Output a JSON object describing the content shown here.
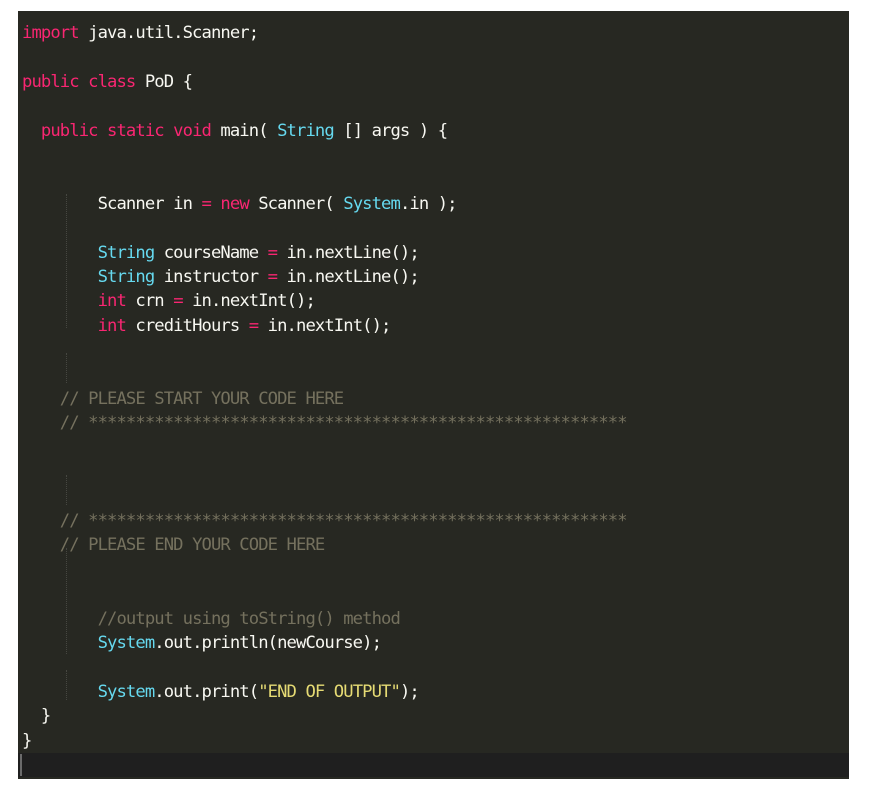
{
  "editor": {
    "theme_colors": {
      "background": "#272822",
      "keyword": "#f92672",
      "type": "#66d9ef",
      "string": "#e6db74",
      "comment": "#75715e",
      "text": "#f8f8f2"
    },
    "lines": [
      [
        {
          "t": "import",
          "c": "kw"
        },
        {
          "t": " java.util.Scanner;",
          "c": ""
        }
      ],
      [],
      [
        {
          "t": "public class",
          "c": "kw"
        },
        {
          "t": " PoD {",
          "c": ""
        }
      ],
      [],
      [
        {
          "t": "  "
        },
        {
          "t": "public static void",
          "c": "kw"
        },
        {
          "t": " main( ",
          "c": ""
        },
        {
          "t": "String",
          "c": "ty"
        },
        {
          "t": " [] args ) {",
          "c": ""
        }
      ],
      [],
      [],
      [
        {
          "t": "        Scanner in ",
          "c": ""
        },
        {
          "t": "=",
          "c": "kw"
        },
        {
          "t": " ",
          "c": ""
        },
        {
          "t": "new",
          "c": "kw"
        },
        {
          "t": " Scanner( ",
          "c": ""
        },
        {
          "t": "System",
          "c": "ty"
        },
        {
          "t": ".in );",
          "c": ""
        }
      ],
      [],
      [
        {
          "t": "        "
        },
        {
          "t": "String",
          "c": "ty"
        },
        {
          "t": " courseName ",
          "c": ""
        },
        {
          "t": "=",
          "c": "kw"
        },
        {
          "t": " in.nextLine();",
          "c": ""
        }
      ],
      [
        {
          "t": "        "
        },
        {
          "t": "String",
          "c": "ty"
        },
        {
          "t": " instructor ",
          "c": ""
        },
        {
          "t": "=",
          "c": "kw"
        },
        {
          "t": " in.nextLine();",
          "c": ""
        }
      ],
      [
        {
          "t": "        "
        },
        {
          "t": "int",
          "c": "kw"
        },
        {
          "t": " crn ",
          "c": ""
        },
        {
          "t": "=",
          "c": "kw"
        },
        {
          "t": " in.nextInt();",
          "c": ""
        }
      ],
      [
        {
          "t": "        "
        },
        {
          "t": "int",
          "c": "kw"
        },
        {
          "t": " creditHours ",
          "c": ""
        },
        {
          "t": "=",
          "c": "kw"
        },
        {
          "t": " in.nextInt();",
          "c": ""
        }
      ],
      [],
      [],
      [
        {
          "t": "    "
        },
        {
          "t": "// PLEASE START YOUR CODE HERE",
          "c": "cm"
        }
      ],
      [
        {
          "t": "    "
        },
        {
          "t": "// *********************************************************",
          "c": "cm"
        }
      ],
      [],
      [],
      [],
      [
        {
          "t": "    "
        },
        {
          "t": "// *********************************************************",
          "c": "cm"
        }
      ],
      [
        {
          "t": "    "
        },
        {
          "t": "// PLEASE END YOUR CODE HERE",
          "c": "cm"
        }
      ],
      [],
      [],
      [
        {
          "t": "        "
        },
        {
          "t": "//output using toString() method",
          "c": "cm"
        }
      ],
      [
        {
          "t": "        "
        },
        {
          "t": "System",
          "c": "ty"
        },
        {
          "t": ".out.println(newCourse);",
          "c": ""
        }
      ],
      [],
      [
        {
          "t": "        "
        },
        {
          "t": "System",
          "c": "ty"
        },
        {
          "t": ".out.print(",
          "c": ""
        },
        {
          "t": "\"END OF OUTPUT\"",
          "c": "str"
        },
        {
          "t": ");",
          "c": ""
        }
      ],
      [
        {
          "t": "  }",
          "c": ""
        }
      ],
      [
        {
          "t": "}",
          "c": ""
        }
      ],
      []
    ],
    "current_line": 30
  }
}
